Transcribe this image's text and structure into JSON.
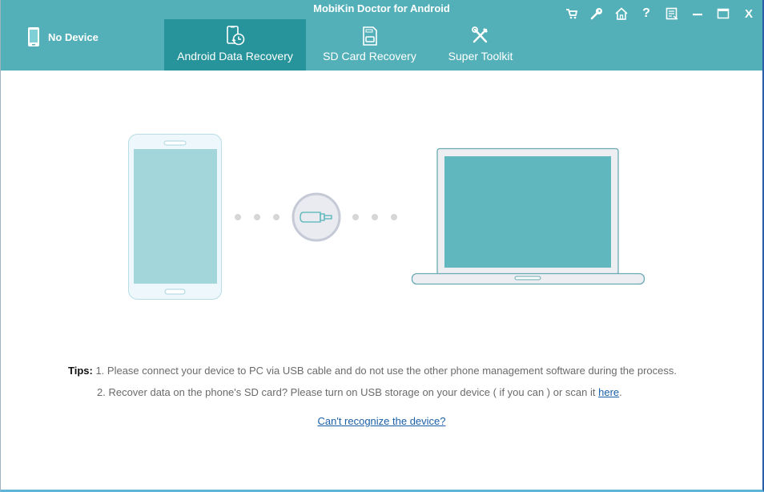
{
  "window": {
    "title": "MobiKin Doctor for Android"
  },
  "device": {
    "icon": "phone-icon",
    "label": "No Device"
  },
  "tabs": [
    {
      "label": "Android Data Recovery",
      "icon": "phone-restore-icon",
      "active": true
    },
    {
      "label": "SD Card Recovery",
      "icon": "sd-card-icon",
      "active": false
    },
    {
      "label": "Super Toolkit",
      "icon": "tools-icon",
      "active": false
    }
  ],
  "window_controls": [
    {
      "name": "cart",
      "icon": "cart-icon"
    },
    {
      "name": "register",
      "icon": "key-icon"
    },
    {
      "name": "home",
      "icon": "home-icon"
    },
    {
      "name": "help",
      "icon": "help-icon",
      "glyph": "?"
    },
    {
      "name": "feedback",
      "icon": "feedback-icon"
    },
    {
      "name": "minimize",
      "icon": "minimize-icon"
    },
    {
      "name": "maximize",
      "icon": "maximize-icon"
    },
    {
      "name": "close",
      "icon": "close-icon",
      "glyph": "X"
    }
  ],
  "illustration": {
    "phone": "phone-illustration",
    "connector": "usb-cable-icon",
    "computer": "laptop-illustration",
    "colors": {
      "phone_screen": "#a3d6db",
      "laptop_screen": "#60b7bd",
      "connector_stroke": "#55b5b8"
    }
  },
  "tips": {
    "label": "Tips:",
    "line1": "1. Please connect your device to PC via USB cable and do not use the other phone management software during the process.",
    "line2_prefix": "2. Recover data on the phone's SD card? Please turn on USB storage on your device ( if you can ) or scan it ",
    "line2_link": "here",
    "line2_suffix": "."
  },
  "help_link": "Can't recognize the device?",
  "colors": {
    "header": "#53b0b8",
    "active_tab": "#27939b",
    "link": "#1a5fa8"
  }
}
